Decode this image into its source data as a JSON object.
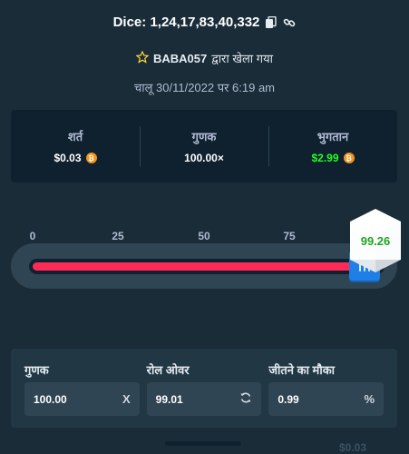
{
  "header": {
    "title": "Dice: 1,24,17,83,40,332",
    "player_name": "BABA057",
    "played_by_suffix": "द्वारा खेला गया",
    "date_text": "चालू 30/11/2022 पर 6:19 am"
  },
  "stats": {
    "bet_label": "शर्त",
    "bet_value": "$0.03",
    "multiplier_label": "गुणक",
    "multiplier_value": "100.00×",
    "payout_label": "भुगतान",
    "payout_value": "$2.99",
    "coin_symbol": "₿"
  },
  "slider": {
    "ticks": [
      "0",
      "25",
      "50",
      "75"
    ],
    "result_value": "99.26"
  },
  "bottom": {
    "multiplier_label": "गुणक",
    "multiplier_value": "100.00",
    "multiplier_suffix": "X",
    "rollover_label": "रोल ओवर",
    "rollover_value": "99.01",
    "chance_label": "जीतने का मौका",
    "chance_value": "0.99",
    "chance_suffix": "%"
  },
  "footer_partial_text": "$0.03",
  "colors": {
    "background": "#1a2c38",
    "panel": "#0f212e",
    "payout_green": "#1fff20",
    "track_red": "#ff2a55",
    "handle_blue": "#1f7fe6",
    "dice_result_green": "#1fa51f"
  },
  "icons": {
    "copy": "copy-icon",
    "link": "link-icon",
    "star": "star-icon",
    "coin": "bitcoin-icon",
    "refresh": "refresh-icon"
  }
}
